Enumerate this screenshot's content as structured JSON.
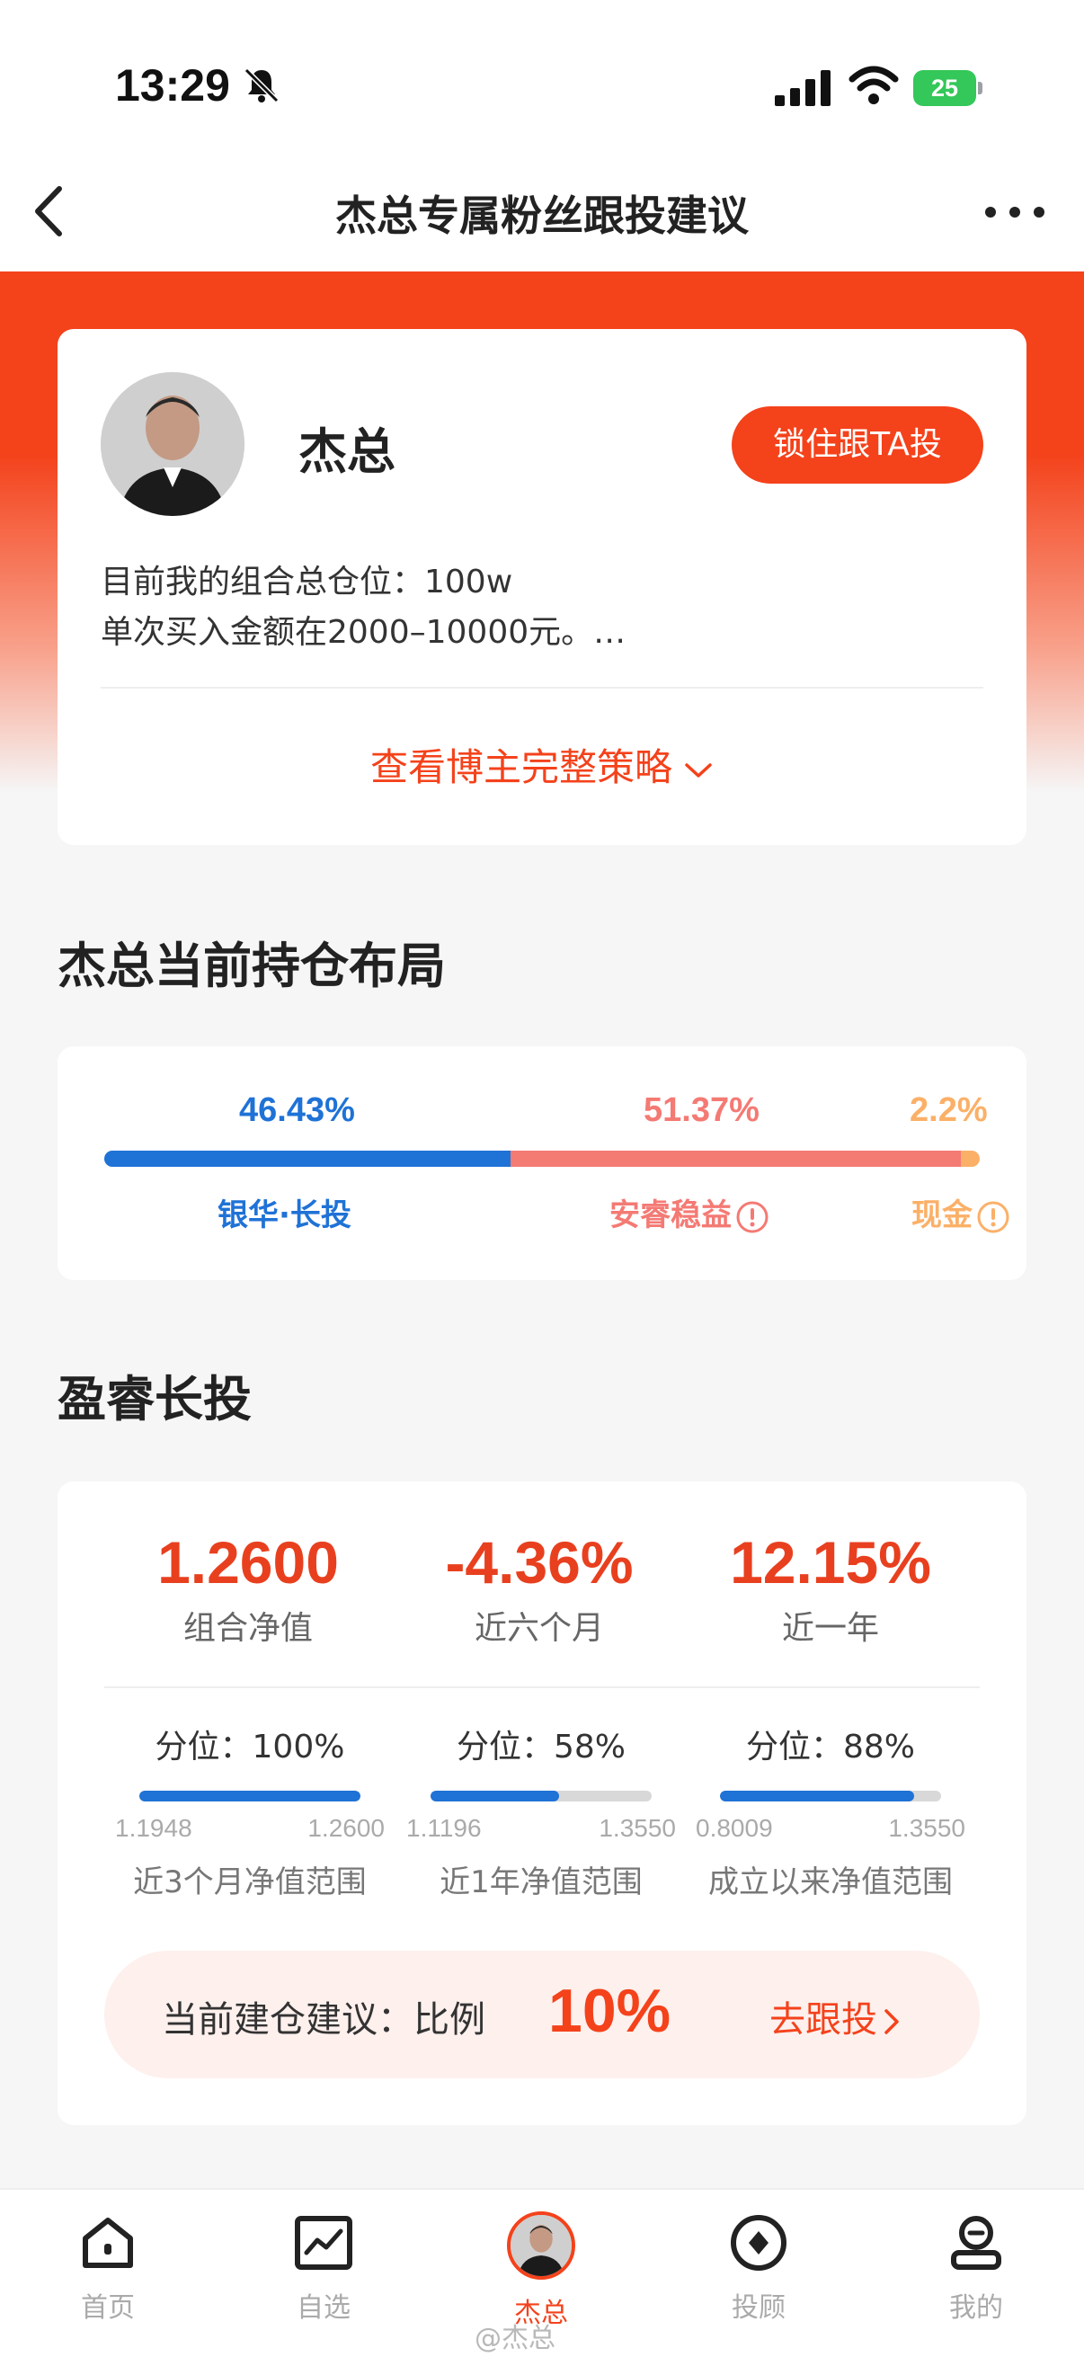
{
  "status_bar": {
    "time": "13:29",
    "battery": "25"
  },
  "nav": {
    "title": "杰总专属粉丝跟投建议"
  },
  "profile": {
    "name": "杰总",
    "follow_label": "锁住跟TA投",
    "strategy_line1": "目前我的组合总仓位：100w",
    "strategy_line2": "单次买入金额在2000–10000元。…",
    "view_strategy_label": "查看博主完整策略"
  },
  "holdings": {
    "title": "杰总当前持仓布局",
    "items": [
      {
        "pct_label": "46.43%",
        "share": 46.43,
        "name": "银华·长投",
        "color": "#1f72d6",
        "info": false
      },
      {
        "pct_label": "51.37%",
        "share": 51.37,
        "name": "安睿稳益",
        "color": "#f47a74",
        "info": true
      },
      {
        "pct_label": "2.2%",
        "share": 2.2,
        "name": "现金",
        "color": "#fbb068",
        "info": true
      }
    ]
  },
  "portfolio": {
    "title": "盈睿长投",
    "stats": [
      {
        "value": "1.2600",
        "label": "组合净值"
      },
      {
        "value": "-4.36%",
        "label": "近六个月"
      },
      {
        "value": "12.15%",
        "label": "近一年"
      }
    ],
    "ranges": [
      {
        "title": "分位：100%",
        "percentile": 100,
        "low": "1.1948",
        "high": "1.2600",
        "label": "近3个月净值范围"
      },
      {
        "title": "分位：58%",
        "percentile": 58,
        "low": "1.1196",
        "high": "1.3550",
        "label": "近1年净值范围"
      },
      {
        "title": "分位：88%",
        "percentile": 88,
        "low": "0.8009",
        "high": "1.3550",
        "label": "成立以来净值范围"
      }
    ],
    "suggest_text": "当前建仓建议：比例",
    "suggest_pct": "10%",
    "go_follow_label": "去跟投"
  },
  "tabs": [
    {
      "label": "首页",
      "icon": "home-icon",
      "active": false
    },
    {
      "label": "自选",
      "icon": "chart-icon",
      "active": false
    },
    {
      "label": "杰总",
      "icon": "avatar",
      "active": true
    },
    {
      "label": "投顾",
      "icon": "compass-icon",
      "active": false
    },
    {
      "label": "我的",
      "icon": "profile-icon",
      "active": false
    }
  ],
  "watermark": "@杰总",
  "colors": {
    "accent": "#f4421b",
    "blue": "#1f72d6"
  }
}
